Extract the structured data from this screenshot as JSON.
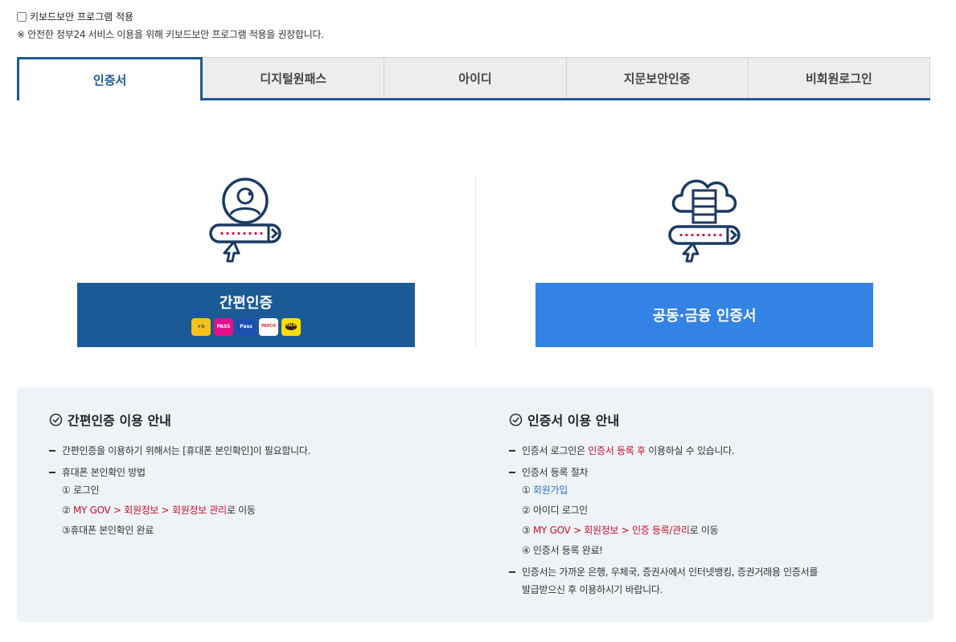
{
  "keyboard_security": {
    "checkbox_label": "키보드보안 프로그램 적용",
    "notice": "※ 안전한 정부24 서비스 이용을 위해 키보드보안 프로그램 적용을 권장합니다."
  },
  "tabs": [
    {
      "label": "인증서",
      "active": true
    },
    {
      "label": "디지털원패스",
      "active": false
    },
    {
      "label": "아이디",
      "active": false
    },
    {
      "label": "지문보안인증",
      "active": false
    },
    {
      "label": "비회원로그인",
      "active": false
    }
  ],
  "login_options": {
    "simple_auth": {
      "label": "간편인증",
      "icon": "user-password-login-icon",
      "providers": [
        "KB국민인증서",
        "PASS",
        "Samsung Pass",
        "PAYCO",
        "TALK"
      ]
    },
    "certificate": {
      "label": "공동·금융 인증서",
      "icon": "cloud-certificate-login-icon"
    }
  },
  "colors": {
    "primary": "#1b5a96",
    "secondary_button": "#3382e6",
    "panel_bg": "#eef3f7",
    "highlight_red": "#c8102e",
    "link_blue": "#2f6fbf"
  },
  "simple_guide": {
    "title": "간편인증 이용 안내",
    "item1": "간편인증을 이용하기 위해서는 [휴대폰 본인확인]이 필요합니다.",
    "item2": "휴대폰 본인확인 방법",
    "step1": "① 로그인",
    "step2_prefix": "② ",
    "step2_highlight": "MY GOV > 회원정보 > 회원정보 관리",
    "step2_suffix": "로 이동",
    "step3": "③휴대폰 본인확인 완료"
  },
  "cert_guide": {
    "title": "인증서 이용 안내",
    "item1_prefix": "인증서 로그인은 ",
    "item1_highlight": "인증서 등록 후",
    "item1_suffix": " 이용하실 수 있습니다.",
    "item2": "인증서 등록 절차",
    "step1_prefix": "① ",
    "step1_link": "회원가입",
    "step2": "② 아이디 로그인",
    "step3_prefix": "③ ",
    "step3_highlight": "MY GOV > 회원정보 > 인증 등록/관리",
    "step3_suffix": "로 이동",
    "step4": "④ 인증서 등록 완료!",
    "item3_line1": "인증서는 가까운 은행, 우체국, 증권사에서 인터넷뱅킹, 증권거래용 인증서를",
    "item3_line2": "발급받으신 후 이용하시기 바랍니다."
  }
}
